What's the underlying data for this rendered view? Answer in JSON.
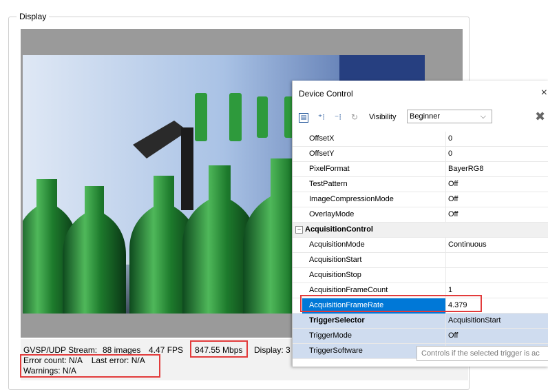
{
  "display": {
    "group_title": "Display",
    "status": {
      "line1_stream": "GVSP/UDP Stream:",
      "line1_images": "88 images",
      "line1_fps": "4.47 FPS",
      "line1_mbps": "847.55 Mbps",
      "line1_display": "Display: 3",
      "error_line": "Error count: N/A    Last error: N/A",
      "warnings_line": "Warnings: N/A"
    }
  },
  "device_control": {
    "title": "Device Control",
    "close_glyph": "×",
    "visibility_label": "Visibility",
    "visibility_value": "Beginner",
    "rows": [
      {
        "name": "OffsetX",
        "value": "0"
      },
      {
        "name": "OffsetY",
        "value": "0"
      },
      {
        "name": "PixelFormat",
        "value": "BayerRG8"
      },
      {
        "name": "TestPattern",
        "value": "Off"
      },
      {
        "name": "ImageCompressionMode",
        "value": "Off"
      },
      {
        "name": "OverlayMode",
        "value": "Off"
      },
      {
        "name": "AcquisitionControl",
        "value": "",
        "category": true
      },
      {
        "name": "AcquisitionMode",
        "value": "Continuous"
      },
      {
        "name": "AcquisitionStart",
        "value": ""
      },
      {
        "name": "AcquisitionStop",
        "value": ""
      },
      {
        "name": "AcquisitionFrameCount",
        "value": "1"
      },
      {
        "name": "AcquisitionFrameRate",
        "value": "4.379",
        "selected": true
      },
      {
        "name": "TriggerSelector",
        "value": "AcquisitionStart",
        "bold": true
      },
      {
        "name": "TriggerMode",
        "value": "Off"
      },
      {
        "name": "TriggerSoftware",
        "value": ""
      }
    ],
    "tooltip": "Controls if the selected trigger is ac"
  },
  "colors": {
    "highlight_red": "#e23b3b",
    "selection_blue": "#0078d7"
  }
}
